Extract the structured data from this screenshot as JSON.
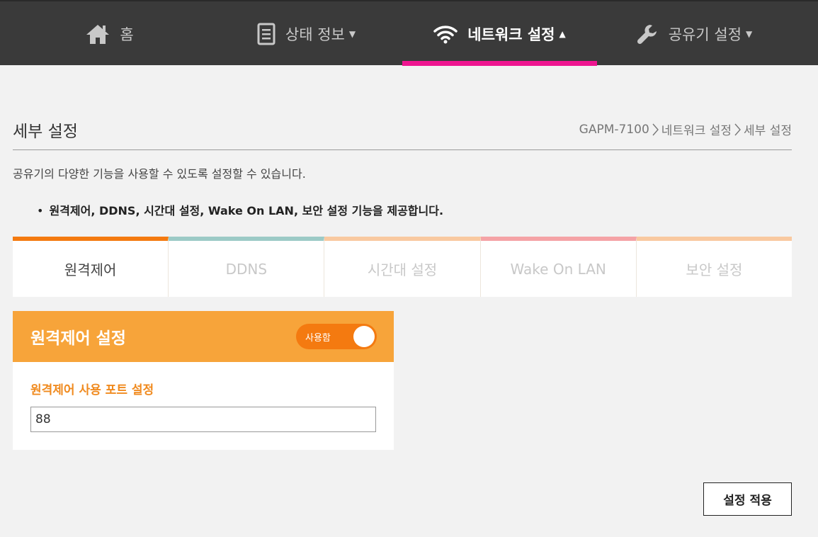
{
  "nav": {
    "home_label": "홈",
    "status_label": "상태 정보",
    "network_label": "네트워크 설정",
    "router_label": "공유기 설정",
    "caret_down": "▼",
    "caret_up": "▲",
    "active_color": "#ee1590"
  },
  "page": {
    "title": "세부 설정",
    "breadcrumb": [
      "GAPM-7100",
      "네트워크 설정",
      "세부 설정"
    ],
    "description": "공유기의 다양한 기능을 사용할 수 있도록 설정할 수 있습니다.",
    "bullet_marker": "•",
    "bullet": "원격제어, DDNS, 시간대 설정, Wake On LAN, 보안 설정 기능을 제공합니다."
  },
  "tabs": [
    {
      "label": "원격제어",
      "color": "#f47a10"
    },
    {
      "label": "DDNS",
      "color": "#9ccac6"
    },
    {
      "label": "시간대 설정",
      "color": "#f9c9a0"
    },
    {
      "label": "Wake On LAN",
      "color": "#f5a3a6"
    },
    {
      "label": "보안 설정",
      "color": "#f9c9a0"
    }
  ],
  "panel": {
    "title": "원격제어 설정",
    "toggle_label": "사용함",
    "toggle_on": true,
    "field_label": "원격제어 사용 포트 설정",
    "port_value": "88"
  },
  "apply_label": "설정 적용"
}
